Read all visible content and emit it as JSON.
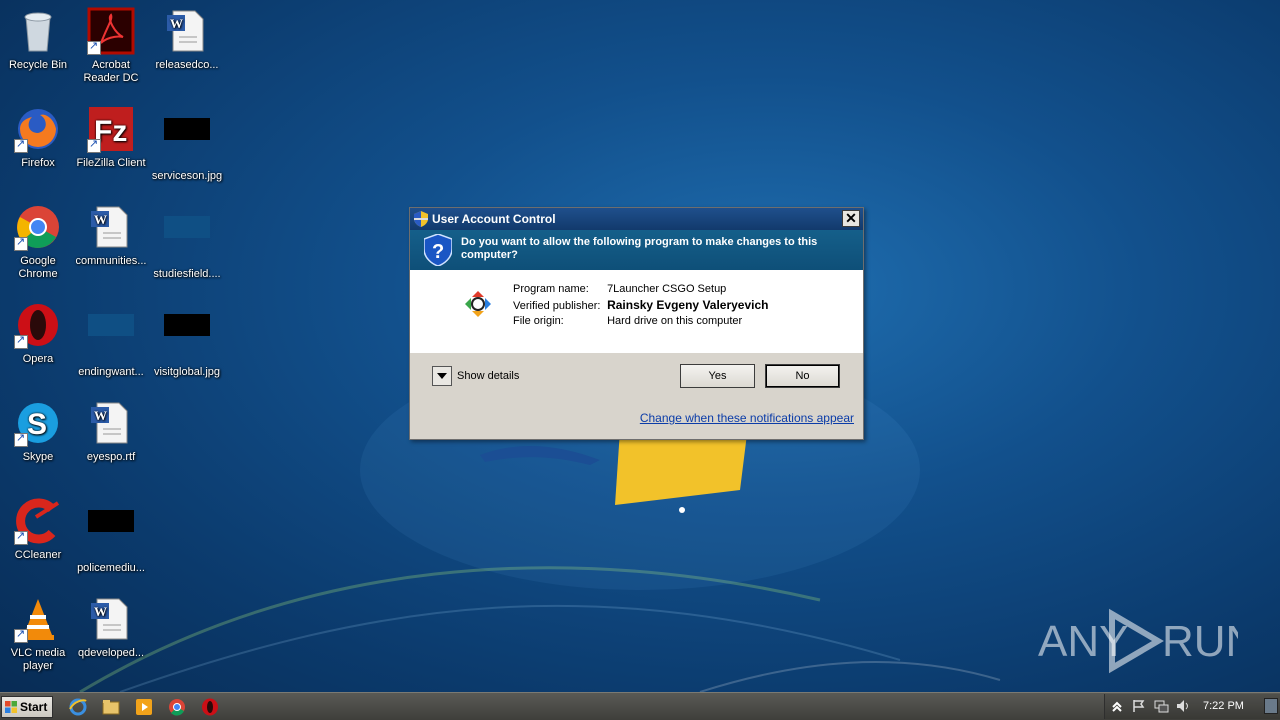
{
  "desktop": {
    "icons": [
      {
        "label": "Recycle Bin"
      },
      {
        "label": "Acrobat\nReader DC"
      },
      {
        "label": "releasedco..."
      },
      {
        "label": "Firefox"
      },
      {
        "label": "FileZilla Client"
      },
      {
        "label": "serviceson.jpg"
      },
      {
        "label": "Google\nChrome"
      },
      {
        "label": "communities..."
      },
      {
        "label": "studiesfield...."
      },
      {
        "label": "Opera"
      },
      {
        "label": "endingwant..."
      },
      {
        "label": "visitglobal.jpg"
      },
      {
        "label": "Skype"
      },
      {
        "label": "eyespo.rtf"
      },
      {
        "label": "CCleaner"
      },
      {
        "label": "policemediu..."
      },
      {
        "label": "VLC media\nplayer"
      },
      {
        "label": "qdeveloped..."
      }
    ]
  },
  "uac": {
    "title": "User Account Control",
    "close_glyph": "✕",
    "question": "Do you want to allow the following program to make changes to this computer?",
    "fields": [
      {
        "label": "Program name:",
        "value": "7Launcher CSGO Setup"
      },
      {
        "label": "Verified publisher:",
        "value": "Rainsky Evgeny Valeryevich"
      },
      {
        "label": "File origin:",
        "value": "Hard drive on this computer"
      }
    ],
    "show_details": "Show details",
    "yes_label": "Yes",
    "no_label": "No",
    "change_link": "Change when these notifications appear"
  },
  "taskbar": {
    "start_label": "Start",
    "clock": "7:22 PM"
  },
  "watermark": {
    "left": "ANY",
    "right": "RUN"
  }
}
